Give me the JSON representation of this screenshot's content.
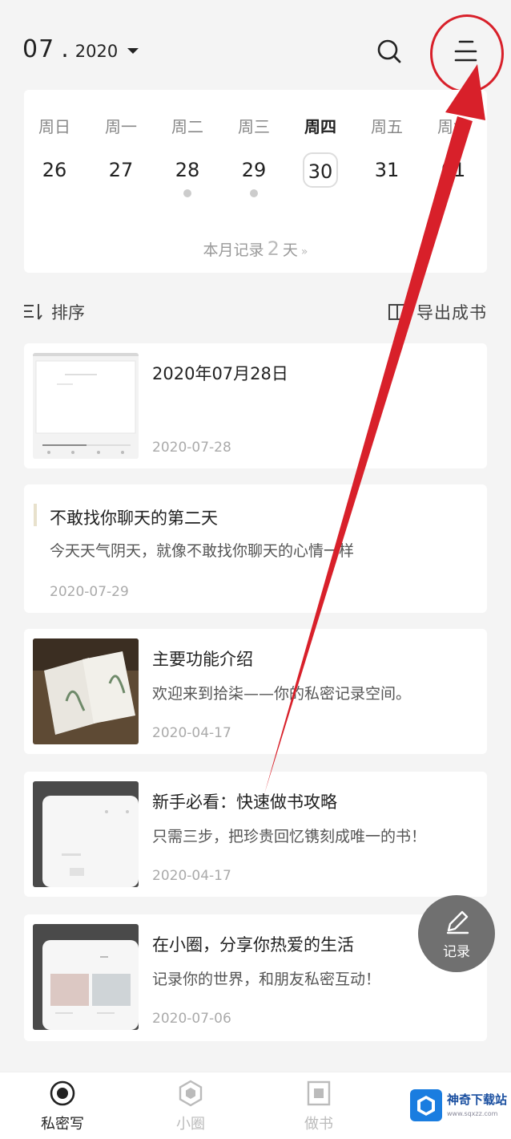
{
  "header": {
    "month": "07",
    "separator": ".",
    "year": "2020"
  },
  "calendar": {
    "weekdays": [
      "周日",
      "周一",
      "周二",
      "周三",
      "周四",
      "周五",
      "周六"
    ],
    "days": [
      "26",
      "27",
      "28",
      "29",
      "30",
      "31",
      "01"
    ],
    "today_index": 4,
    "record_days_with_entries": [
      "28",
      "29"
    ],
    "summary_prefix": "本月记录",
    "summary_count": "2",
    "summary_suffix": "天",
    "summary_chevron": "»"
  },
  "toolbar": {
    "sort_label": "排序",
    "export_label": "导出成书"
  },
  "entries": [
    {
      "title": "2020年07月28日",
      "text": "",
      "date": "2020-07-28"
    },
    {
      "title": "不敢找你聊天的第二天",
      "text": "今天天气阴天，就像不敢找你聊天的心情一样",
      "date": "2020-07-29"
    },
    {
      "title": "主要功能介绍",
      "text": "欢迎来到拾柒——你的私密记录空间。",
      "date": "2020-04-17"
    },
    {
      "title": "新手必看：快速做书攻略",
      "text": "只需三步，把珍贵回忆镌刻成唯一的书！",
      "date": "2020-04-17"
    },
    {
      "title": "在小圈，分享你热爱的生活",
      "text": "记录你的世界，和朋友私密互动！",
      "date": "2020-07-06"
    }
  ],
  "fab": {
    "label": "记录"
  },
  "bottom_nav": {
    "items": [
      {
        "label": "私密写",
        "icon": "record-circle-icon"
      },
      {
        "label": "小圈",
        "icon": "hexagon-icon"
      },
      {
        "label": "做书",
        "icon": "book-square-icon"
      }
    ],
    "active_index": 0
  },
  "watermark": {
    "name": "神奇下载站",
    "url": "www.sqxzz.com"
  },
  "colors": {
    "annotation_red": "#d8202a",
    "fab_gray": "#707070",
    "watermark_blue": "#1a7de0"
  }
}
